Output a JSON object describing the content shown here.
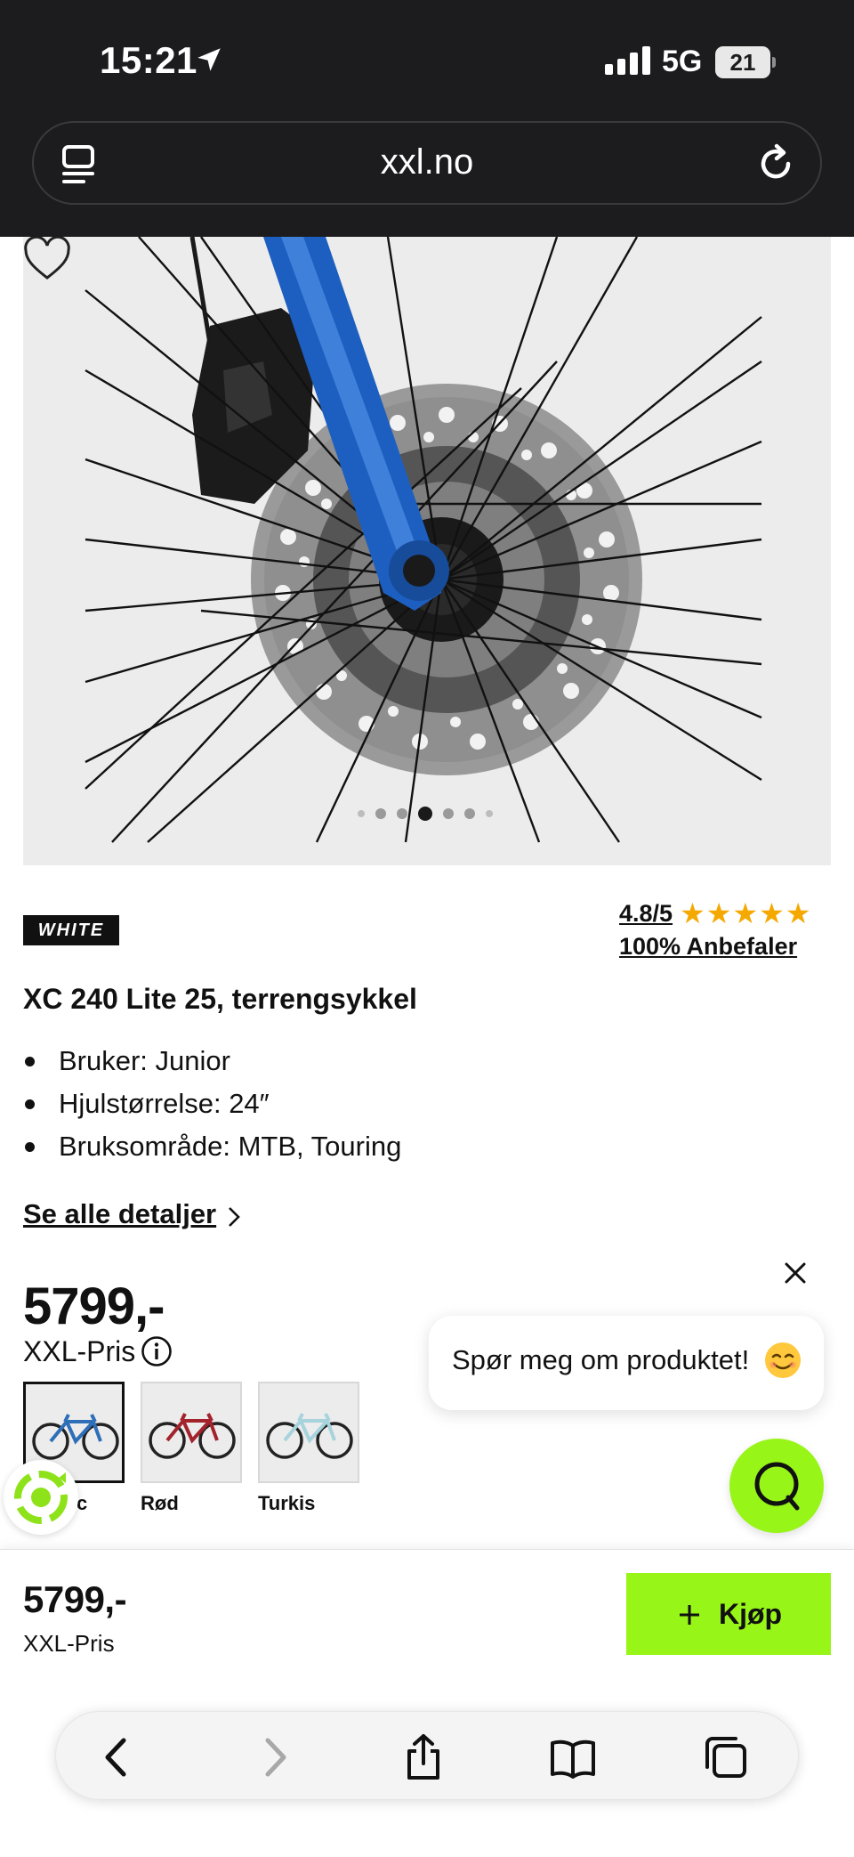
{
  "status": {
    "time": "15:21",
    "network": "5G",
    "battery": "21"
  },
  "browser": {
    "url": "xxl.no"
  },
  "carousel": {
    "total_dots": 7,
    "active_index": 3
  },
  "product": {
    "brand": "WHITE",
    "rating": "4.8/5",
    "stars": "★★★★★",
    "recommend": "100% Anbefaler",
    "title": "XC 240 Lite 25, terrengsykkel",
    "features": [
      "Bruker: Junior",
      "Hjulstørrelse: 24″",
      "Bruksområde: MTB, Touring"
    ],
    "details_link": "Se alle detaljer",
    "price": "5799,-",
    "price_label": "XXL-Pris",
    "variants": [
      {
        "label": "c",
        "frame_color": "#2f6fb8",
        "selected": true
      },
      {
        "label": "Rød",
        "frame_color": "#a3222b",
        "selected": false
      },
      {
        "label": "Turkis",
        "frame_color": "#a7d3dc",
        "selected": false
      }
    ]
  },
  "chat": {
    "prompt": "Spør meg om produktet!",
    "emoji": "😊"
  },
  "buybar": {
    "price": "5799,-",
    "price_label": "XXL-Pris",
    "buy_label": "Kjøp"
  },
  "colors": {
    "accent": "#98f518",
    "star": "#f5a800",
    "bike_frame": "#1d5fc0"
  },
  "toolbar": [
    "back-icon",
    "forward-icon",
    "share-icon",
    "bookmarks-icon",
    "tabs-icon"
  ]
}
